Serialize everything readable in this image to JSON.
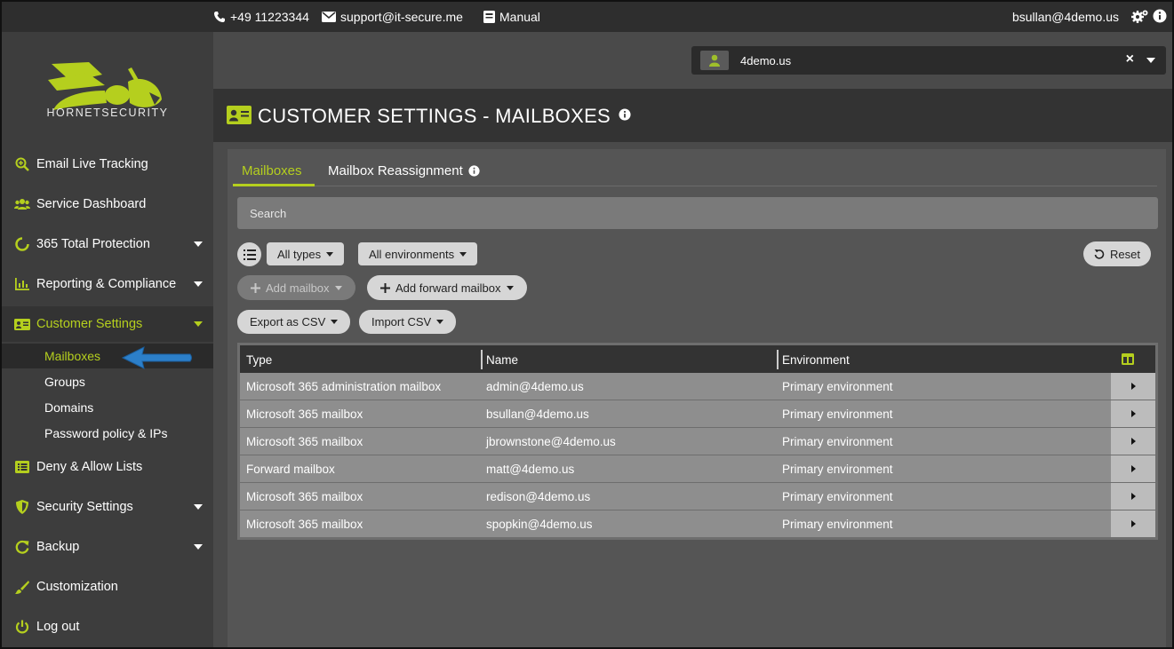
{
  "topbar": {
    "phone": "+49 11223344",
    "email": "support@it-secure.me",
    "manual": "Manual",
    "user": "bsullan@4demo.us"
  },
  "brand": {
    "name": "HORNETSECURITY",
    "accent": "#b5cf1e"
  },
  "customer": {
    "name": "4demo.us",
    "clear_glyph": "×"
  },
  "sidebar": {
    "items": [
      {
        "label": "Email Live Tracking",
        "icon": "search-icon"
      },
      {
        "label": "Service Dashboard",
        "icon": "users-icon"
      },
      {
        "label": "365 Total Protection",
        "icon": "circle-icon"
      },
      {
        "label": "Reporting & Compliance",
        "icon": "bar-chart-icon"
      },
      {
        "label": "Customer Settings",
        "icon": "id-card-icon"
      },
      {
        "label": "Deny & Allow Lists",
        "icon": "list-icon"
      },
      {
        "label": "Security Settings",
        "icon": "shield-icon"
      },
      {
        "label": "Backup",
        "icon": "refresh-icon"
      },
      {
        "label": "Customization",
        "icon": "brush-icon"
      },
      {
        "label": "Log out",
        "icon": "power-icon"
      }
    ],
    "sub_items": [
      "Mailboxes",
      "Groups",
      "Domains",
      "Password policy & IPs"
    ]
  },
  "page": {
    "title": "CUSTOMER SETTINGS - MAILBOXES"
  },
  "tabs": [
    "Mailboxes",
    "Mailbox Reassignment"
  ],
  "search": {
    "placeholder": "Search"
  },
  "filters": {
    "types": "All types",
    "environments": "All environments",
    "reset": "Reset"
  },
  "actions": {
    "add_mailbox": "Add mailbox",
    "add_forward": "Add forward mailbox",
    "export_csv": "Export as CSV",
    "import_csv": "Import CSV"
  },
  "table": {
    "columns": [
      "Type",
      "Name",
      "Environment"
    ],
    "rows": [
      {
        "type": "Microsoft 365 administration mailbox",
        "name": "admin@4demo.us",
        "environment": "Primary environment"
      },
      {
        "type": "Microsoft 365 mailbox",
        "name": "bsullan@4demo.us",
        "environment": "Primary environment"
      },
      {
        "type": "Microsoft 365 mailbox",
        "name": "jbrownstone@4demo.us",
        "environment": "Primary environment"
      },
      {
        "type": "Forward mailbox",
        "name": "matt@4demo.us",
        "environment": "Primary environment"
      },
      {
        "type": "Microsoft 365 mailbox",
        "name": "redison@4demo.us",
        "environment": "Primary environment"
      },
      {
        "type": "Microsoft 365 mailbox",
        "name": "spopkin@4demo.us",
        "environment": "Primary environment"
      }
    ]
  }
}
